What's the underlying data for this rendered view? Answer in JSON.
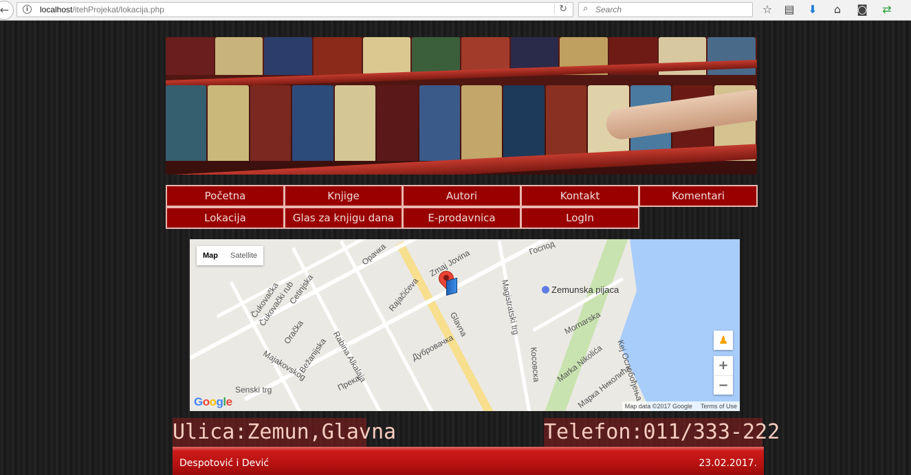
{
  "browser": {
    "url_host": "localhost",
    "url_path": "/itehProjekat/lokacija.php",
    "search_placeholder": "Search"
  },
  "nav": {
    "items": [
      {
        "label": "Početna"
      },
      {
        "label": "Knjige"
      },
      {
        "label": "Autori"
      },
      {
        "label": "Kontakt"
      },
      {
        "label": "Komentari"
      },
      {
        "label": "Lokacija"
      },
      {
        "label": "Glas za knjigu dana"
      },
      {
        "label": "E-prodavnica"
      },
      {
        "label": "LogIn"
      }
    ]
  },
  "map": {
    "type_map": "Map",
    "type_satellite": "Satellite",
    "streets": [
      "Čukovačka",
      "Čukovački rub",
      "Cetinjska",
      "Oračka",
      "Bežanijska",
      "Rabina Alkalaja",
      "Majakovskog",
      "Senski trg",
      "Прека",
      "Дубровачка",
      "Glavna",
      "Rajačićeva",
      "Zmaj Jovina",
      "Oрачка",
      "Magistratski trg",
      "Zemunska pijaca",
      "Mornarska",
      "Марка Николића",
      "Кеј Ослобођења",
      "Косовска",
      "Marka Nikolića",
      "Господ"
    ],
    "google": "Google",
    "attribution": "Map data ©2017 Google",
    "terms": "Terms of Use",
    "zoom_in": "+",
    "zoom_out": "−"
  },
  "info": {
    "address": "Ulica:Zemun,Glavna",
    "phone": "Telefon:011/333-222"
  },
  "footer": {
    "authors": "Despotović i Dević",
    "date": "23.02.2017."
  }
}
